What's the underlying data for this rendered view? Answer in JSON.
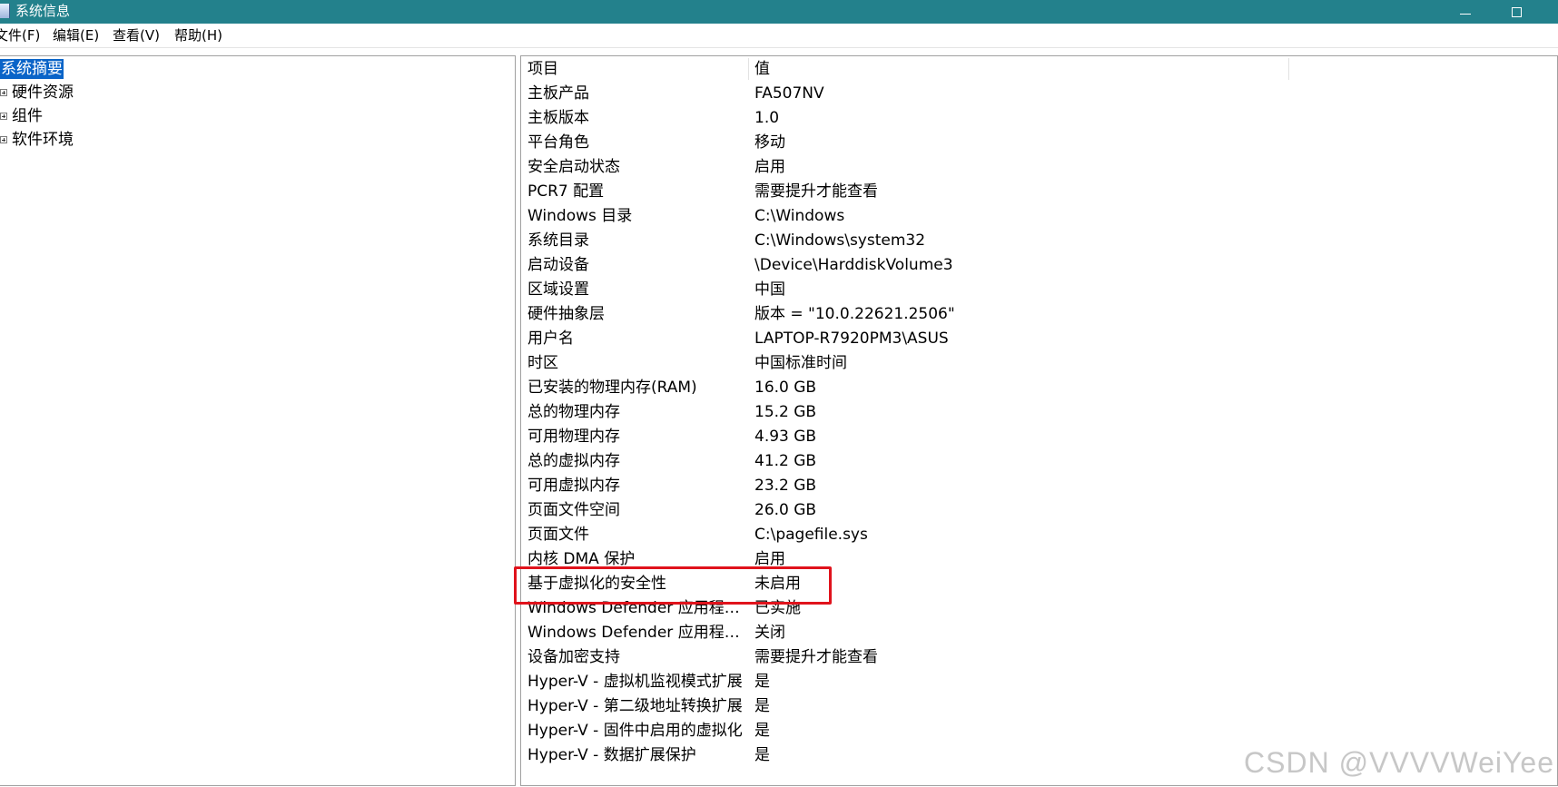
{
  "window": {
    "title": "系统信息",
    "colors": {
      "titlebar": "#23818c",
      "selection": "#0a64c8",
      "highlight_border": "#e0131c"
    }
  },
  "menu": [
    "文件(F)",
    "编辑(E)",
    "查看(V)",
    "帮助(H)"
  ],
  "tree": [
    {
      "label": "系统摘要",
      "selected": true,
      "expandable": false
    },
    {
      "label": "硬件资源",
      "selected": false,
      "expandable": true
    },
    {
      "label": "组件",
      "selected": false,
      "expandable": true
    },
    {
      "label": "软件环境",
      "selected": false,
      "expandable": true
    }
  ],
  "table": {
    "headers": {
      "item": "项目",
      "value": "值"
    },
    "rows": [
      {
        "item": "主板产品",
        "value": "FA507NV"
      },
      {
        "item": "主板版本",
        "value": "1.0"
      },
      {
        "item": "平台角色",
        "value": "移动"
      },
      {
        "item": "安全启动状态",
        "value": "启用"
      },
      {
        "item": "PCR7 配置",
        "value": "需要提升才能查看"
      },
      {
        "item": "Windows 目录",
        "value": "C:\\Windows"
      },
      {
        "item": "系统目录",
        "value": "C:\\Windows\\system32"
      },
      {
        "item": "启动设备",
        "value": "\\Device\\HarddiskVolume3"
      },
      {
        "item": "区域设置",
        "value": "中国"
      },
      {
        "item": "硬件抽象层",
        "value": "版本 = \"10.0.22621.2506\""
      },
      {
        "item": "用户名",
        "value": "LAPTOP-R7920PM3\\ASUS"
      },
      {
        "item": "时区",
        "value": "中国标准时间"
      },
      {
        "item": "已安装的物理内存(RAM)",
        "value": "16.0 GB"
      },
      {
        "item": "总的物理内存",
        "value": "15.2 GB"
      },
      {
        "item": "可用物理内存",
        "value": "4.93 GB"
      },
      {
        "item": "总的虚拟内存",
        "value": "41.2 GB"
      },
      {
        "item": "可用虚拟内存",
        "value": "23.2 GB"
      },
      {
        "item": "页面文件空间",
        "value": "26.0 GB"
      },
      {
        "item": "页面文件",
        "value": "C:\\pagefile.sys"
      },
      {
        "item": "内核 DMA 保护",
        "value": "启用"
      },
      {
        "item": "基于虚拟化的安全性",
        "value": "未启用",
        "highlighted": true
      },
      {
        "item": "Windows Defender 应用程序...",
        "value": "已实施"
      },
      {
        "item": "Windows Defender 应用程序...",
        "value": "关闭"
      },
      {
        "item": "设备加密支持",
        "value": "需要提升才能查看"
      },
      {
        "item": "Hyper-V - 虚拟机监视模式扩展",
        "value": "是"
      },
      {
        "item": "Hyper-V - 第二级地址转换扩展",
        "value": "是"
      },
      {
        "item": "Hyper-V - 固件中启用的虚拟化",
        "value": "是"
      },
      {
        "item": "Hyper-V - 数据扩展保护",
        "value": "是"
      }
    ]
  },
  "watermark": "CSDN @VVVVWeiYee"
}
